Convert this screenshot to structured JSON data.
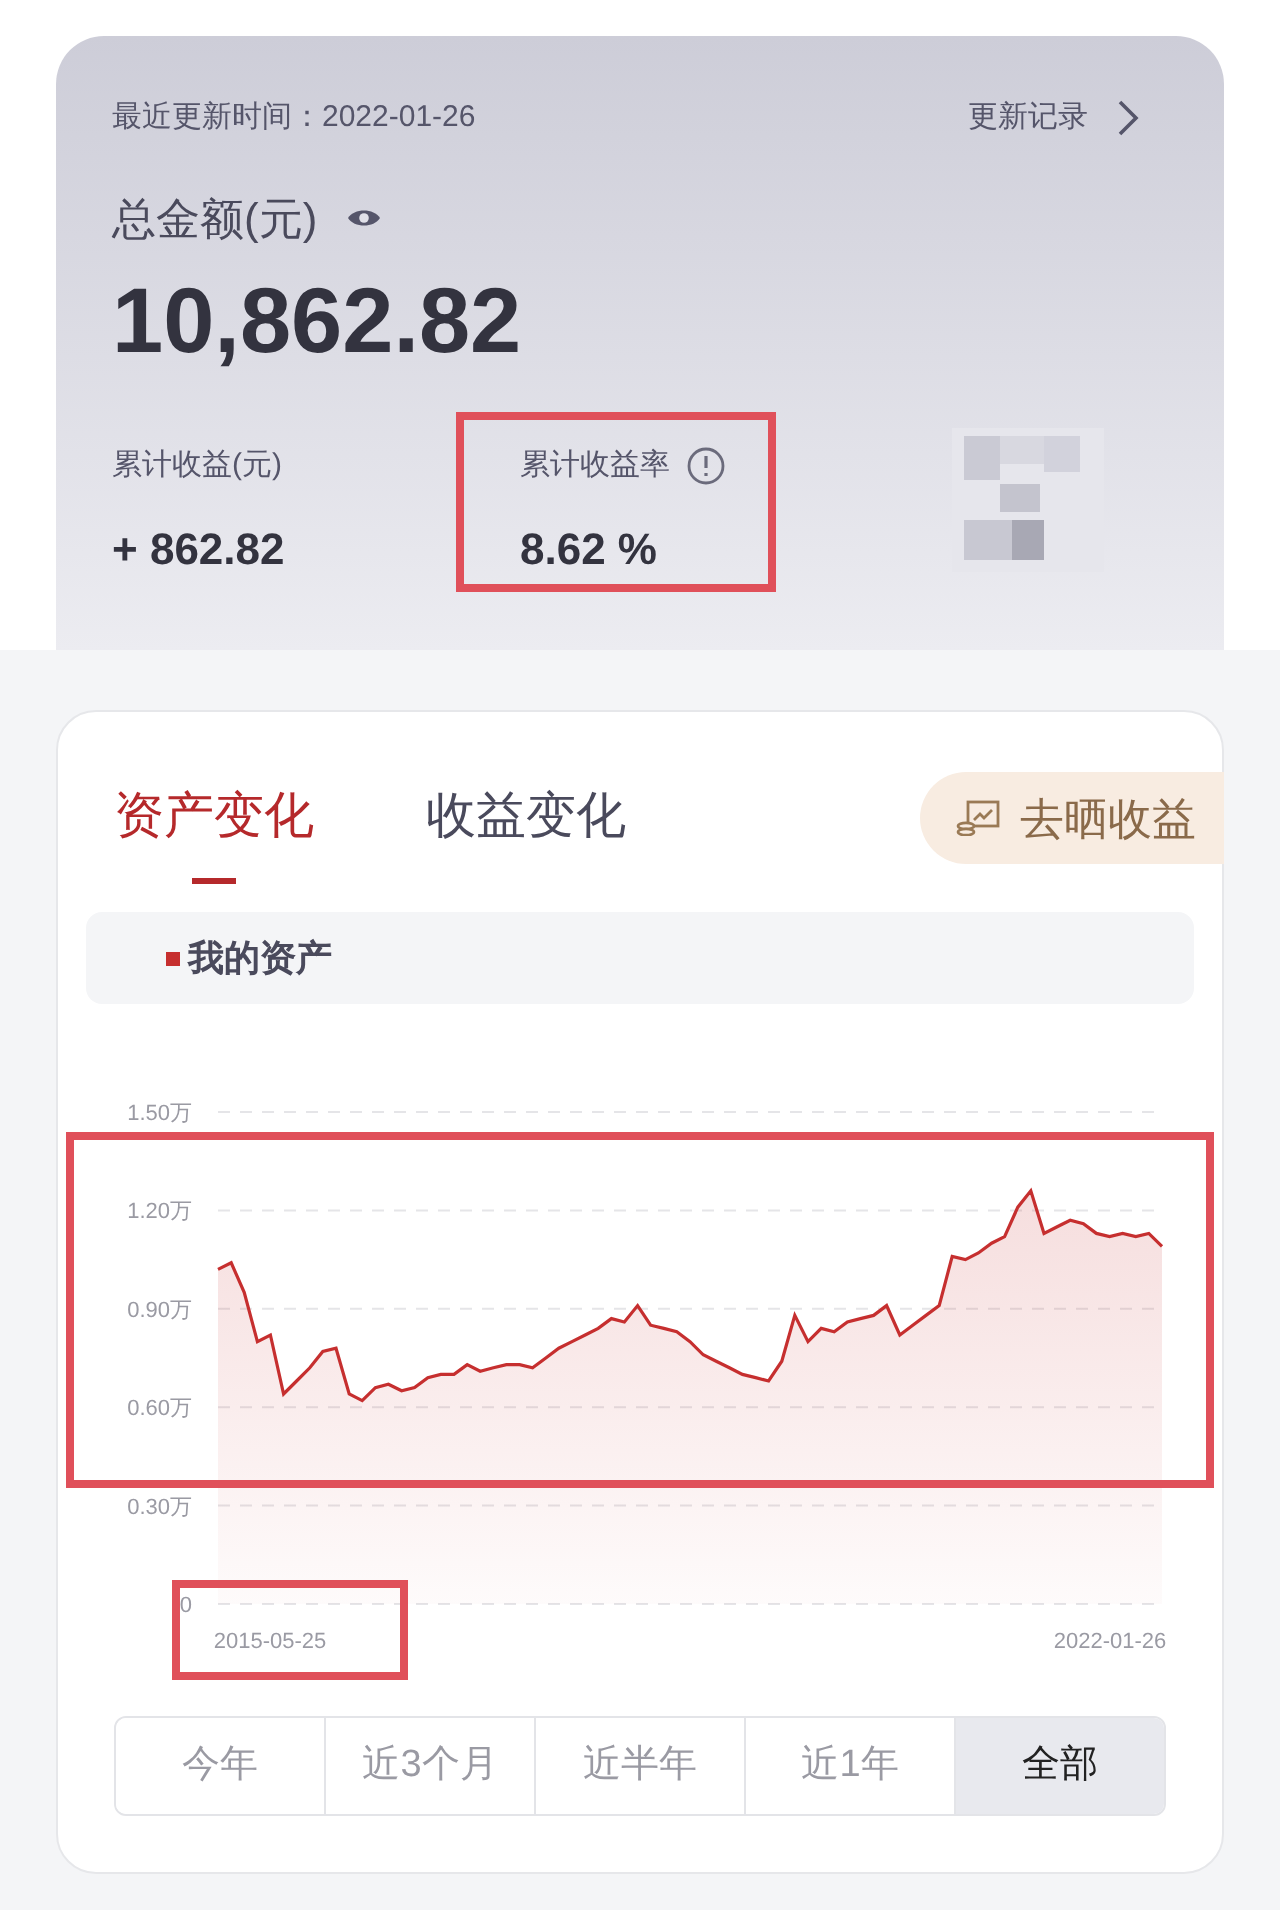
{
  "header": {
    "updated_label": "最近更新时间：2022-01-26",
    "history_link": "更新记录",
    "total_label": "总金额(元)",
    "total_value": "10,862.82",
    "stats": [
      {
        "label": "累计收益(元)",
        "value": "+ 862.82",
        "highlighted": false,
        "info": false
      },
      {
        "label": "累计收益率",
        "value": "8.62 %",
        "highlighted": true,
        "info": true
      }
    ]
  },
  "tabs": [
    {
      "label": "资产变化",
      "selected": true
    },
    {
      "label": "收益变化",
      "selected": false
    }
  ],
  "share_button": "去晒收益",
  "x_axis": {
    "start": "2015-05-25",
    "end": "2022-01-26"
  },
  "highlights": {
    "plot": true,
    "start_date": true
  },
  "chart_data": {
    "type": "area",
    "grid": true,
    "ylim": [
      0,
      1.5
    ],
    "yticks": [
      {
        "value": 0,
        "label": "0"
      },
      {
        "value": 0.3,
        "label": "0.30万"
      },
      {
        "value": 0.6,
        "label": "0.60万"
      },
      {
        "value": 0.9,
        "label": "0.90万"
      },
      {
        "value": 1.2,
        "label": "1.20万"
      },
      {
        "value": 1.5,
        "label": "1.50万"
      }
    ],
    "series": [
      {
        "name": "我的资产",
        "color": "#c62f2f",
        "values": [
          1.02,
          1.04,
          0.95,
          0.8,
          0.82,
          0.64,
          0.68,
          0.72,
          0.77,
          0.78,
          0.64,
          0.62,
          0.66,
          0.67,
          0.65,
          0.66,
          0.69,
          0.7,
          0.7,
          0.73,
          0.71,
          0.72,
          0.73,
          0.73,
          0.72,
          0.75,
          0.78,
          0.8,
          0.82,
          0.84,
          0.87,
          0.86,
          0.91,
          0.85,
          0.84,
          0.83,
          0.8,
          0.76,
          0.74,
          0.72,
          0.7,
          0.69,
          0.68,
          0.74,
          0.88,
          0.8,
          0.84,
          0.83,
          0.86,
          0.87,
          0.88,
          0.91,
          0.82,
          0.85,
          0.88,
          0.91,
          1.06,
          1.05,
          1.07,
          1.1,
          1.12,
          1.21,
          1.26,
          1.13,
          1.15,
          1.17,
          1.16,
          1.13,
          1.12,
          1.13,
          1.12,
          1.13,
          1.09
        ]
      }
    ]
  },
  "ranges": [
    {
      "label": "今年",
      "selected": false
    },
    {
      "label": "近3个月",
      "selected": false
    },
    {
      "label": "近半年",
      "selected": false
    },
    {
      "label": "近1年",
      "selected": false
    },
    {
      "label": "全部",
      "selected": true
    }
  ]
}
